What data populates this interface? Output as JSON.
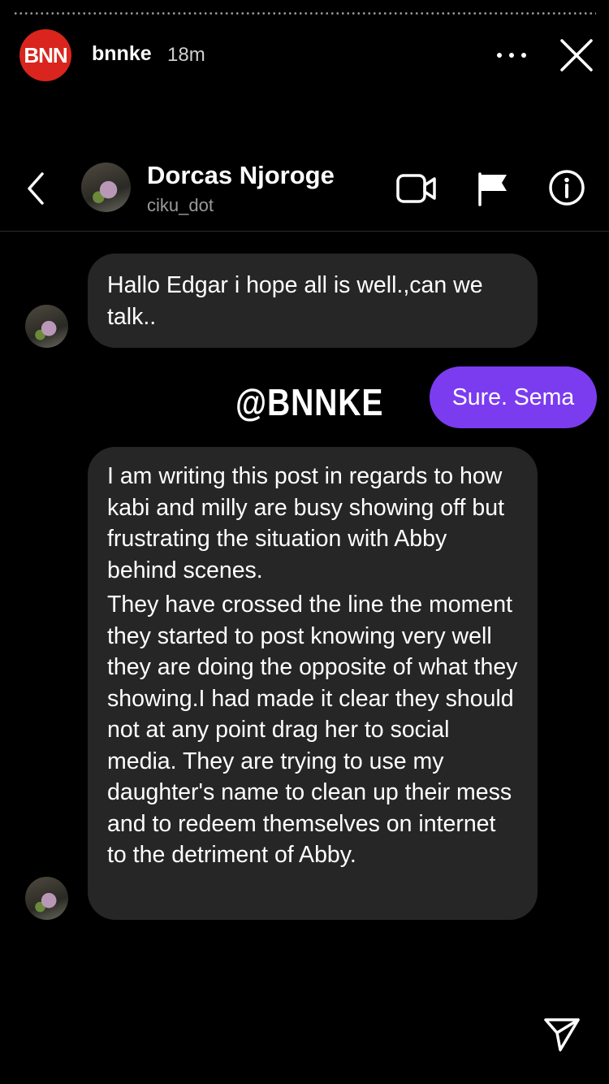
{
  "story": {
    "logo_text": "BNN",
    "username": "bnnke",
    "time": "18m",
    "more_icon": "more-horizontal-icon",
    "close_icon": "close-icon",
    "logo_color": "#d9251d"
  },
  "dm_header": {
    "name": "Dorcas Njoroge",
    "handle": "ciku_dot",
    "icons": [
      "back-icon",
      "video-call-icon",
      "flag-icon",
      "info-icon"
    ]
  },
  "messages": [
    {
      "direction": "received",
      "text": "Hallo Edgar i hope all is well.,can we talk.."
    },
    {
      "direction": "sent",
      "text": "Sure. Sema",
      "color": "#7b3cf0"
    },
    {
      "direction": "received",
      "paragraphs": [
        "I am writing this post in regards to how kabi and milly are busy showing off but frustrating the situation with Abby behind scenes.",
        "They have crossed the line the moment they started to post knowing very well they are doing the opposite of what they showing.I had made it clear they should not at any point drag her to social media. They are trying to use my daughter's name to clean up their mess and to redeem themselves on internet to the detriment of Abby."
      ]
    }
  ],
  "watermark": "@BNNKE",
  "footer": {
    "send_icon": "send-icon"
  }
}
